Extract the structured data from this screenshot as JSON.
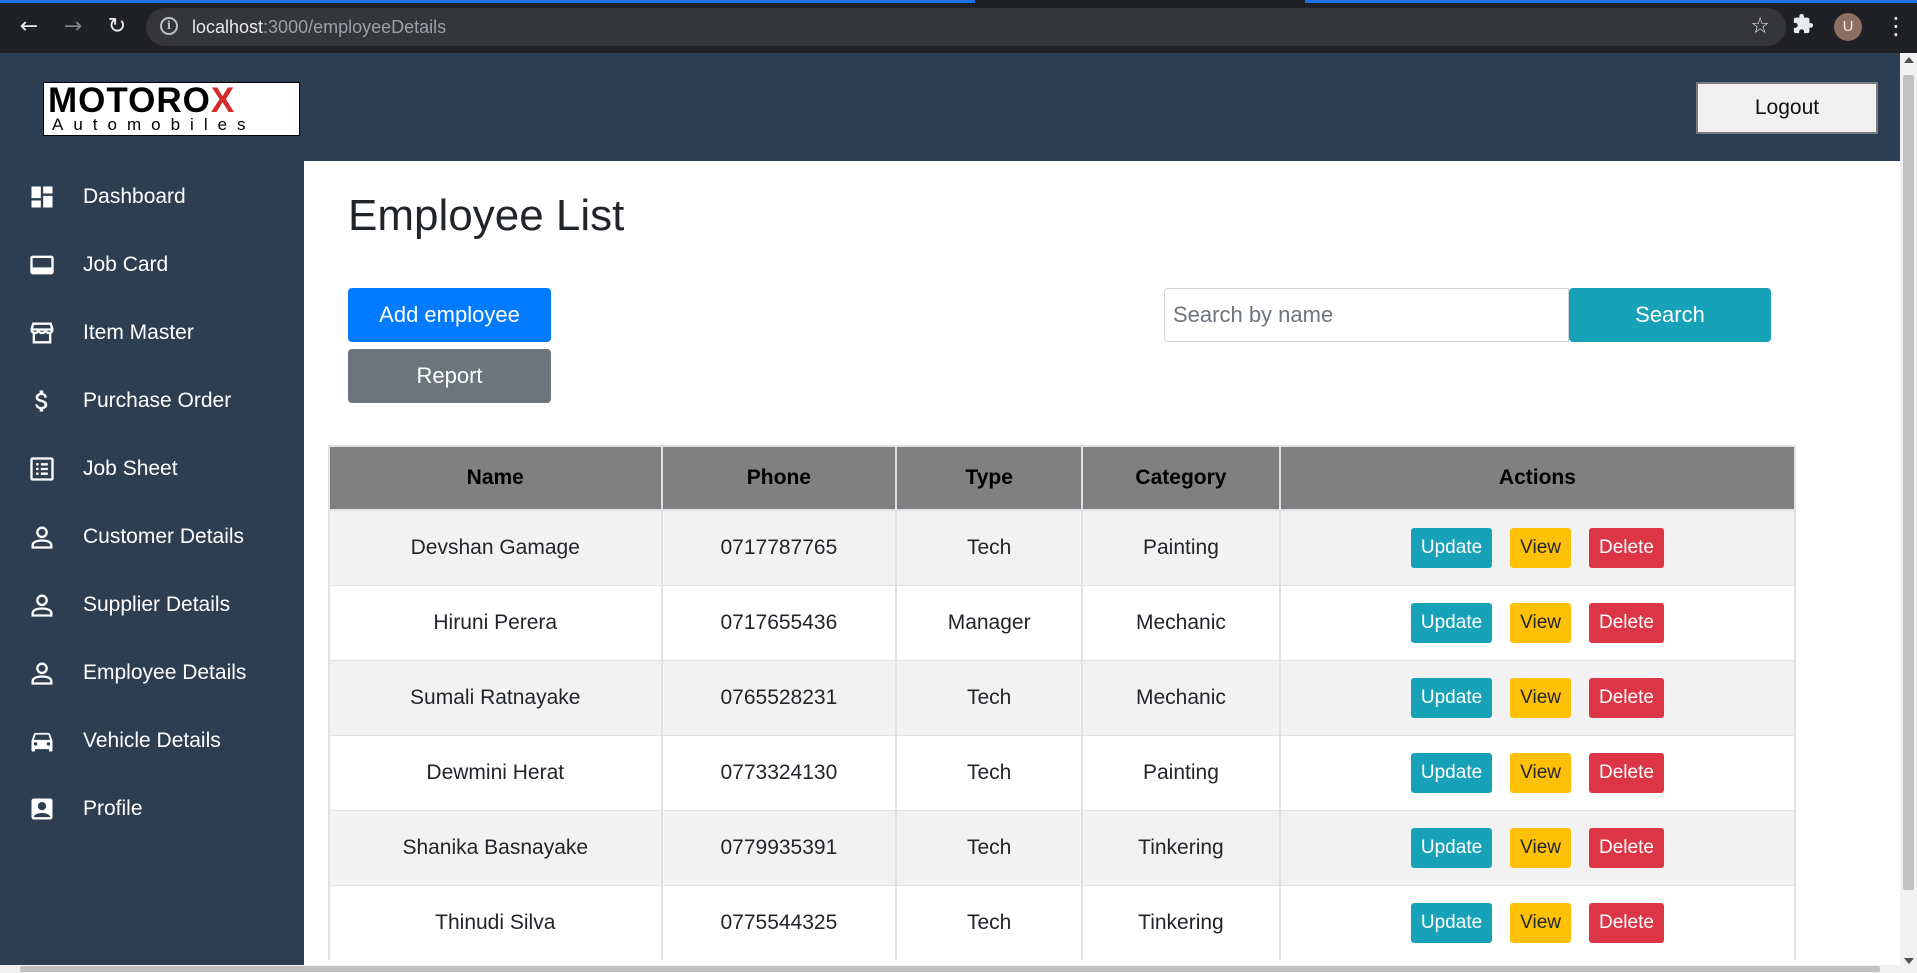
{
  "browser": {
    "url_host": "localhost",
    "url_path": ":3000/employeeDetails",
    "avatar_letter": "U"
  },
  "header": {
    "logo_brand_prefix": "MOTORO",
    "logo_brand_x": "X",
    "logo_sub": "Automobiles",
    "logout_label": "Logout"
  },
  "sidebar": {
    "items": [
      {
        "label": "Dashboard",
        "icon": "dashboard-icon"
      },
      {
        "label": "Job Card",
        "icon": "card-icon"
      },
      {
        "label": "Item Master",
        "icon": "store-icon"
      },
      {
        "label": "Purchase Order",
        "icon": "dollar-icon"
      },
      {
        "label": "Job Sheet",
        "icon": "list-icon"
      },
      {
        "label": "Customer Details",
        "icon": "person-icon"
      },
      {
        "label": "Supplier Details",
        "icon": "person-icon"
      },
      {
        "label": "Employee Details",
        "icon": "person-icon"
      },
      {
        "label": "Vehicle Details",
        "icon": "car-icon"
      },
      {
        "label": "Profile",
        "icon": "profile-icon"
      }
    ]
  },
  "main": {
    "title": "Employee List",
    "add_label": "Add employee",
    "report_label": "Report",
    "search_placeholder": "Search by name",
    "search_label": "Search"
  },
  "table": {
    "headers": [
      "Name",
      "Phone",
      "Type",
      "Category",
      "Actions"
    ],
    "action_labels": {
      "update": "Update",
      "view": "View",
      "delete": "Delete"
    },
    "rows": [
      {
        "name": "Devshan Gamage",
        "phone": "0717787765",
        "type": "Tech",
        "category": "Painting"
      },
      {
        "name": "Hiruni Perera",
        "phone": "0717655436",
        "type": "Manager",
        "category": "Mechanic"
      },
      {
        "name": "Sumali Ratnayake",
        "phone": "0765528231",
        "type": "Tech",
        "category": "Mechanic"
      },
      {
        "name": "Dewmini Herat",
        "phone": "0773324130",
        "type": "Tech",
        "category": "Painting"
      },
      {
        "name": "Shanika Basnayake",
        "phone": "0779935391",
        "type": "Tech",
        "category": "Tinkering"
      },
      {
        "name": "Thinudi Silva",
        "phone": "0775544325",
        "type": "Tech",
        "category": "Tinkering"
      }
    ]
  },
  "colors": {
    "sidebar_bg": "#2c3e50",
    "primary": "#007bff",
    "secondary": "#6c757d",
    "info": "#17a2b8",
    "warning": "#ffc107",
    "danger": "#dc3545",
    "table_header": "#808080"
  }
}
